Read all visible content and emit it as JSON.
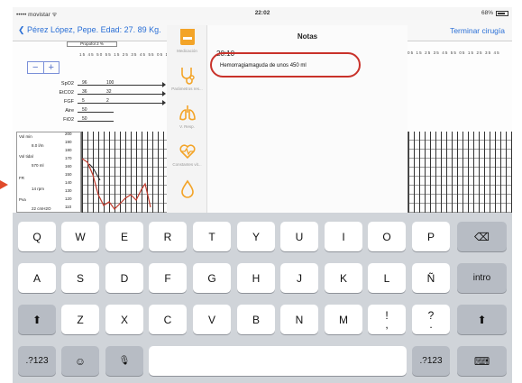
{
  "status_bar": {
    "carrier": "••••• movistar ᯤ",
    "time": "22:02",
    "battery": "68%"
  },
  "nav": {
    "back_label": "Pérez López, Pepe. Edad: 27. 89 Kg.",
    "right_label": "Terminar cirugía",
    "partial_row": "Propofol 2 %"
  },
  "monitor": {
    "zoom_minus": "−",
    "zoom_plus": "+",
    "scale_ticks": "15 45 50 55 15 25 35 45 55 05 15",
    "scale_ticks_right": "05 15 25 35 45 55 05 15 25 35 45",
    "parameters": [
      {
        "name": "SpO2",
        "v1": "96",
        "v2": "100"
      },
      {
        "name": "EtCO2",
        "v1": "36",
        "v2": "32"
      },
      {
        "name": "FGF",
        "v1": "5",
        "v2": "2"
      },
      {
        "name": "Aire",
        "v1": "50",
        "v2": ""
      },
      {
        "name": "FiO2",
        "v1": "50",
        "v2": ""
      }
    ],
    "panel_labels": [
      "Vol min",
      "8.0 l/m",
      "Vol tidal",
      "570 ml",
      "FR",
      "14 rpm",
      "Pva",
      "22 cmH2O"
    ],
    "axis_ticks": [
      "200",
      "190",
      "180",
      "170",
      "160",
      "150",
      "140",
      "130",
      "120",
      "110"
    ]
  },
  "popover": {
    "sidebar": [
      {
        "icon": "medication-icon",
        "label": "Medicación"
      },
      {
        "icon": "stethoscope-icon",
        "label": "Parámetros res..."
      },
      {
        "icon": "lungs-icon",
        "label": "V. Resp."
      },
      {
        "icon": "heartbeat-icon",
        "label": "Constantes vit..."
      },
      {
        "icon": "drop-icon",
        "label": ""
      }
    ],
    "title": "Notas",
    "time": "20:10",
    "note_text": "Hemorragiamaguda de unos 450 ml"
  },
  "keyboard": {
    "row1": [
      "Q",
      "W",
      "E",
      "R",
      "T",
      "Y",
      "U",
      "I",
      "O",
      "P"
    ],
    "row2": [
      "A",
      "S",
      "D",
      "F",
      "G",
      "H",
      "J",
      "K",
      "L",
      "Ñ"
    ],
    "row3": [
      "Z",
      "X",
      "C",
      "V",
      "B",
      "N",
      "M"
    ],
    "punct1": [
      "!",
      ","
    ],
    "punct2": [
      "?",
      "."
    ],
    "return_label": "intro",
    "numbers_label": ".?123",
    "emoji_label": "☺",
    "mic_label": "🎙",
    "delete_label": "⌫",
    "shift_label": "⬆",
    "hide_label": "⌨"
  },
  "colors": {
    "accent": "#2a6fd6",
    "icon_orange": "#f3a428",
    "highlight_ring": "#c9322a",
    "pointer": "#e04a2a"
  }
}
